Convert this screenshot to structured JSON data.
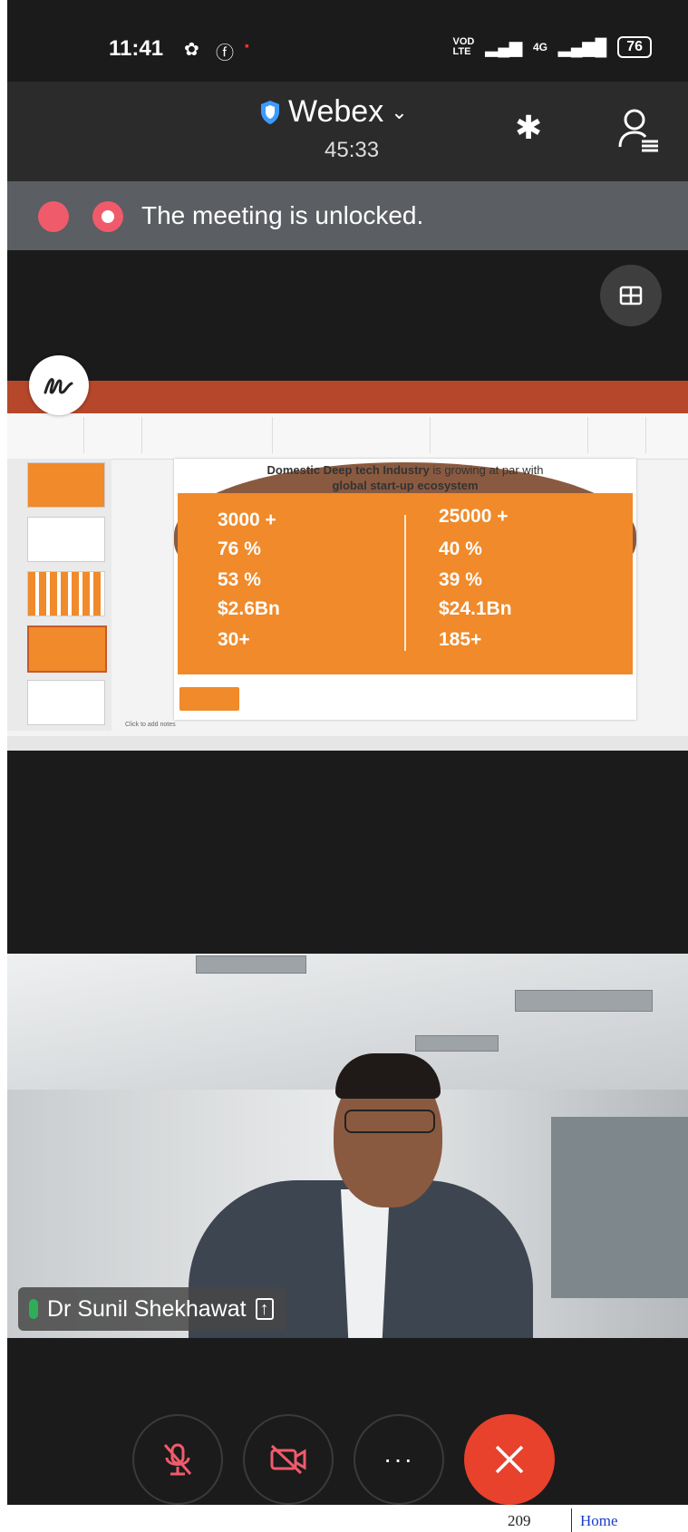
{
  "status_bar": {
    "time": "11:41",
    "network": "VOD LTE",
    "signal_4g": "4G",
    "battery": "76"
  },
  "header": {
    "app_title": "Webex",
    "timer": "45:33"
  },
  "notice": {
    "message": "The meeting is unlocked."
  },
  "shared_slide": {
    "title_bold": "Domestic Deep tech Industry",
    "title_rest": " is growing at par with",
    "title_line2": "global start-up ecosystem",
    "stats_left": [
      "3000 +",
      "76 %",
      "53 %",
      "$2.6Bn",
      "30+"
    ],
    "stats_right": [
      "25000 +",
      "40 %",
      "39 %",
      "$24.1Bn",
      "185+"
    ],
    "notes_placeholder": "Click to add notes"
  },
  "video": {
    "participant_name": "Dr Sunil Shekhawat"
  },
  "footer": {
    "page_number": "209",
    "home_link": "Home"
  },
  "colors": {
    "end_call": "#e8412c",
    "slide_orange": "#f08a2a",
    "badge": "#f05b6b"
  }
}
